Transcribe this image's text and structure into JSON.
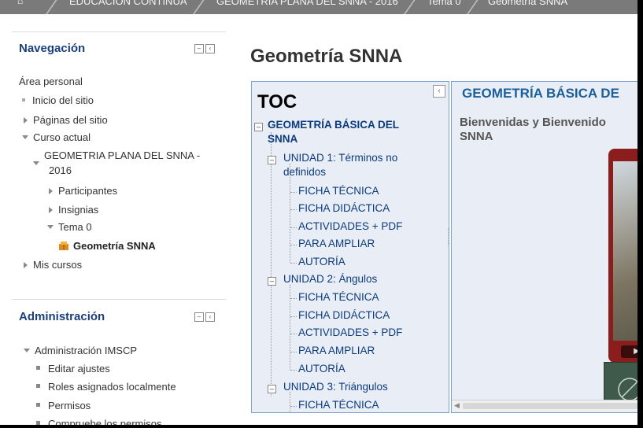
{
  "breadcrumb": {
    "items": [
      "EDUCACIÓN CONTINUA",
      "GEOMETRIA PLANA DEL SNNA - 2016",
      "Tema 0",
      "Geometría SNNA"
    ]
  },
  "navigation": {
    "title": "Navegación",
    "area_personal": "Área personal",
    "items": {
      "inicio": "Inicio del sitio",
      "paginas": "Páginas del sitio",
      "curso_actual": "Curso actual",
      "course_line1": "GEOMETRIA PLANA DEL SNNA -",
      "course_line2": "2016",
      "participantes": "Participantes",
      "insignias": "Insignias",
      "tema0": "Tema 0",
      "geometria": "Geometría SNNA",
      "mis_cursos": "Mis cursos"
    }
  },
  "administration": {
    "title": "Administración",
    "root": "Administración IMSCP",
    "items": [
      "Editar ajustes",
      "Roles asignados localmente",
      "Permisos",
      "Compruebe los permisos"
    ]
  },
  "page": {
    "title": "Geometría SNNA"
  },
  "toc": {
    "title": "TOC",
    "collapse_icon": "‹",
    "root_line1": "GEOMETRÍA BÁSICA DEL",
    "root_line2": "SNNA",
    "unit1_line1": "UNIDAD 1: Términos no",
    "unit1_line2": "definidos",
    "unit1_children": [
      "FICHA TÉCNICA",
      "FICHA DIDÁCTICA",
      "ACTIVIDADES + PDF",
      "PARA AMPLIAR",
      "AUTORÍA"
    ],
    "unit2": "UNIDAD 2: Ángulos",
    "unit2_children": [
      "FICHA TÉCNICA",
      "FICHA DIDÁCTICA",
      "ACTIVIDADES + PDF",
      "PARA AMPLIAR",
      "AUTORÍA"
    ],
    "unit3": "UNIDAD 3: Triángulos",
    "unit3_children": [
      "FICHA TÉCNICA"
    ]
  },
  "content": {
    "title": "GEOMETRÍA BÁSICA DE",
    "text_line1": "Bienvenidas  y  Bienvenido",
    "text_line2": "SNNA",
    "play_label": "▶"
  }
}
